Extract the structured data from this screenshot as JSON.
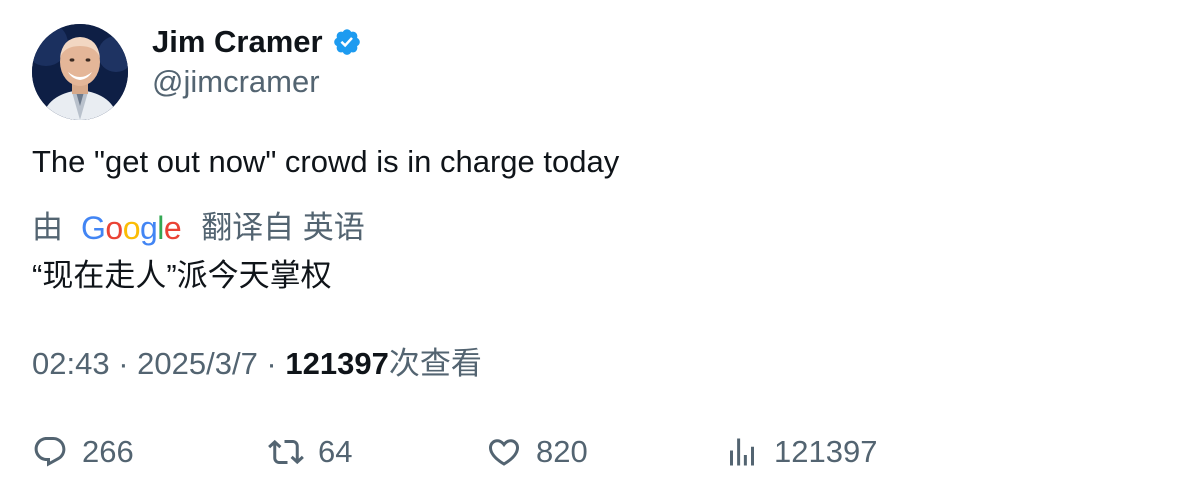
{
  "author": {
    "display_name": "Jim Cramer",
    "handle": "@jimcramer",
    "verified": true,
    "verified_color": "#1d9bf0"
  },
  "tweet": {
    "text": "The \"get out now\" crowd is in charge today"
  },
  "translation": {
    "by_label": "由",
    "provider": "Google",
    "from_label": "翻译自 英语",
    "text": "“现在走人”派今天掌权"
  },
  "meta": {
    "time": "02:43",
    "separator": " · ",
    "date": "2025/3/7",
    "views_count": "121397",
    "views_label": "次查看"
  },
  "actions": {
    "replies": "266",
    "retweets": "64",
    "likes": "820",
    "views": "121397"
  },
  "icons": {
    "reply": "reply-icon",
    "retweet": "retweet-icon",
    "like": "heart-icon",
    "views": "analytics-icon",
    "verified": "verified-badge-icon"
  },
  "colors": {
    "text_primary": "#0f1419",
    "text_secondary": "#536471"
  }
}
